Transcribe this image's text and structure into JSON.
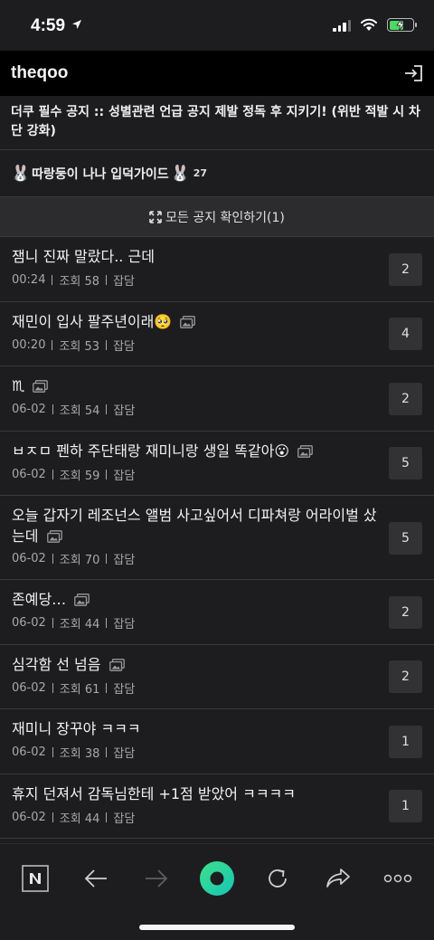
{
  "status_bar": {
    "time": "4:59"
  },
  "header": {
    "title": "theqoo"
  },
  "notices": {
    "main": "더쿠 필수 공지 :: 성별관련 언급 공지 제발 정독 후 지키기! (위반 적발 시 차단 강화)",
    "guide_label": "따랑둥이 나나 입덕가이드",
    "guide_count": "27",
    "all_label": "모든 공지 확인하기(1)"
  },
  "posts": [
    {
      "title": "잼니 진짜 말랐다.. 근데",
      "time": "00:24",
      "views": "조회 58",
      "category": "잡담",
      "replies": "2",
      "has_image": false
    },
    {
      "title": "재민이 입사 팔주년이래🥺",
      "time": "00:20",
      "views": "조회 53",
      "category": "잡담",
      "replies": "4",
      "has_image": true
    },
    {
      "title": "♏︎",
      "time": "06-02",
      "views": "조회 54",
      "category": "잡담",
      "replies": "2",
      "has_image": true
    },
    {
      "title": "ㅂㅈㅁ 펜하 주단태랑 재미니랑 생일 똑같아😮",
      "time": "06-02",
      "views": "조회 59",
      "category": "잡담",
      "replies": "5",
      "has_image": true
    },
    {
      "title": "오늘 갑자기 레조넌스 앨범 사고싶어서 디파쳐랑 어라이벌 샀는데",
      "time": "06-02",
      "views": "조회 70",
      "category": "잡담",
      "replies": "5",
      "has_image": true
    },
    {
      "title": "존예당…",
      "time": "06-02",
      "views": "조회 44",
      "category": "잡담",
      "replies": "2",
      "has_image": true
    },
    {
      "title": "심각함 선 넘음",
      "time": "06-02",
      "views": "조회 61",
      "category": "잡담",
      "replies": "2",
      "has_image": true
    },
    {
      "title": "재미니 장꾸야 ㅋㅋㅋ",
      "time": "06-02",
      "views": "조회 38",
      "category": "잡담",
      "replies": "1",
      "has_image": false
    },
    {
      "title": "휴지 던져서 감독님한테 +1점 받았어 ㅋㅋㅋㅋ",
      "time": "06-02",
      "views": "조회 44",
      "category": "잡담",
      "replies": "1",
      "has_image": false
    }
  ],
  "toolbar": {
    "items": [
      "naver-n-icon",
      "back-arrow-icon",
      "forward-arrow-icon",
      "green-dot-icon",
      "reload-icon",
      "share-icon",
      "more-icon"
    ]
  },
  "colors": {
    "background": "#1d1d1f",
    "header": "#000000",
    "accent": "#4cd964"
  }
}
